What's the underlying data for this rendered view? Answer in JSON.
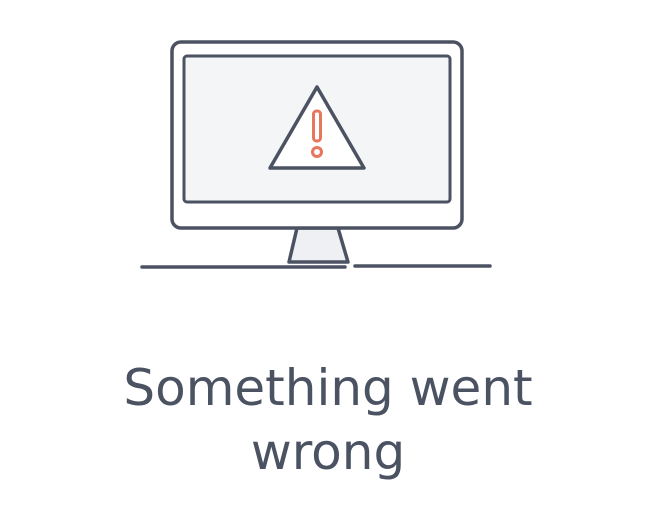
{
  "error": {
    "icon": "monitor-warning-icon",
    "title_line1": "Something went",
    "title_line2": "wrong"
  },
  "colors": {
    "stroke": "#4b5262",
    "screen_fill": "#f4f5f7",
    "alert_accent": "#e8765c",
    "text": "#4b5262"
  }
}
